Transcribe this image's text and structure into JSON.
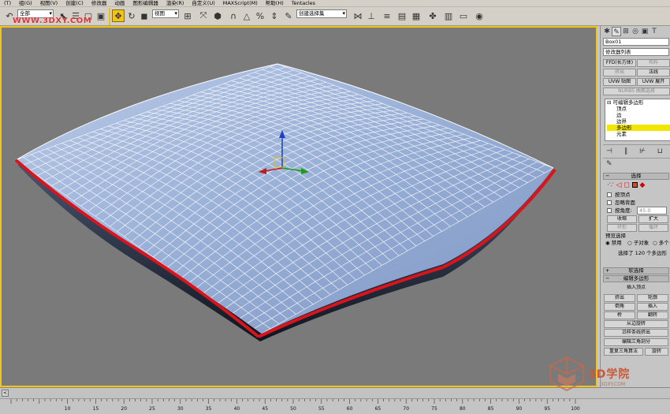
{
  "menubar": {
    "items": [
      "(T)",
      "组(G)",
      "视图(V)",
      "创建(C)",
      "修改器",
      "动画",
      "图形编辑器",
      "渲染(R)",
      "自定义(U)",
      "MAXScript(M)",
      "帮助(H)",
      "Tentacles"
    ]
  },
  "toolbar": {
    "selection_filter": "全部",
    "ref_coord": "视图",
    "named_selection_placeholder": "创建选择集",
    "watermark": "WWW.3DXY.COM"
  },
  "viewport": {
    "label": "",
    "pillow_color": "#8fa6cf",
    "edge_color": "#d8141c",
    "background": "#7a7a7a"
  },
  "panel": {
    "object_name": "Box01",
    "modifier_list": "修改器列表",
    "buttons": {
      "ffd": "FFD(长方体)",
      "cloth": "布料",
      "extrude": "挤出",
      "lathe": "法线",
      "uvw_map": "UVW 贴图",
      "uvw_unwrap": "UVW 展开",
      "nurms": "NURBS 曲面选择"
    },
    "stack": {
      "root": "可编辑多边形",
      "vertex": "顶点",
      "edge": "边",
      "border": "边界",
      "polygon": "多边形",
      "element": "元素"
    },
    "selection": {
      "title": "选择",
      "by_vertex": "按顶点",
      "ignore_backface": "忽略背面",
      "by_angle": "按角度:",
      "angle_value": "45.0",
      "shrink": "收缩",
      "grow": "扩大",
      "ring": "环形",
      "loop": "循环",
      "preview_title": "预览选择",
      "preview_disabled": "禁用",
      "preview_subobj": "子对象",
      "preview_multi": "多个",
      "status": "选择了 120 个多边形"
    },
    "soft_selection": "软选择",
    "edit_poly": {
      "title": "编辑多边形",
      "insert_vertex": "插入顶点",
      "extrude": "挤出",
      "outline": "轮廓",
      "bevel": "倒角",
      "inset": "插入",
      "bridge": "桥",
      "flip": "翻转",
      "hinge": "从边旋转",
      "extrude_spline": "沿样条线挤出",
      "edit_tri": "编辑三角剖分",
      "retriangulate": "重复三角算法",
      "turn": "旋转"
    }
  },
  "timeline": {
    "slider_label": "<",
    "ticks": [
      "10",
      "15",
      "20",
      "25",
      "30",
      "35",
      "40",
      "45",
      "50",
      "55",
      "60",
      "65",
      "70",
      "75",
      "80",
      "85",
      "90",
      "95",
      "100"
    ]
  },
  "logo": {
    "title": "3D学院",
    "subtitle": "3DXY.COM"
  }
}
